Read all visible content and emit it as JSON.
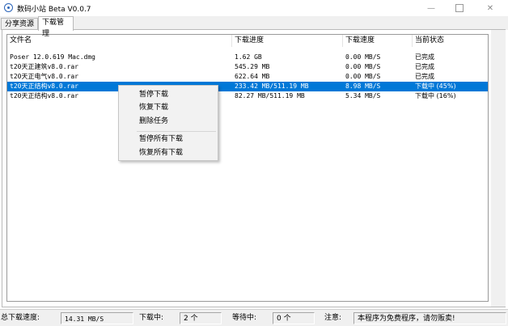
{
  "window": {
    "title": "数码小站 Beta V0.0.7"
  },
  "tabs": [
    {
      "label": "分享资源",
      "active": false
    },
    {
      "label": "下载管理",
      "active": true
    }
  ],
  "table": {
    "headers": [
      "文件名",
      "下载进度",
      "下载速度",
      "当前状态"
    ],
    "rows": [
      {
        "name": "Poser 12.0.619 Mac.dmg",
        "progress": "1.62 GB",
        "speed": "0.00 MB/S",
        "status": "已完成",
        "selected": false
      },
      {
        "name": "t20天正建筑v8.0.rar",
        "progress": "545.29 MB",
        "speed": "0.00 MB/S",
        "status": "已完成",
        "selected": false
      },
      {
        "name": "t20天正电气v8.0.rar",
        "progress": "622.64 MB",
        "speed": "0.00 MB/S",
        "status": "已完成",
        "selected": false
      },
      {
        "name": "t20天正结构v8.0.rar",
        "progress": "233.42 MB/511.19 MB",
        "speed": "8.98 MB/S",
        "status": "下载中 (45%)",
        "selected": true
      },
      {
        "name": "t20天正结构v8.0.rar",
        "progress": "82.27 MB/511.19 MB",
        "speed": "5.34 MB/S",
        "status": "下载中 (16%)",
        "selected": false
      }
    ]
  },
  "context_menu": {
    "items": [
      "暂停下载",
      "恢复下载",
      "删除任务",
      "暂停所有下载",
      "恢复所有下载"
    ]
  },
  "statusbar": {
    "total_speed_label": "总下载速度:",
    "total_speed_value": "14.31 MB/S",
    "downloading_label": "下载中:",
    "downloading_value": "2 个",
    "waiting_label": "等待中:",
    "waiting_value": "0 个",
    "notice_label": "注意:",
    "notice_value": "本程序为免费程序，请勿贩卖!"
  },
  "colors": {
    "selection": "#0078d7",
    "window_bg": "#f0f0f0"
  }
}
